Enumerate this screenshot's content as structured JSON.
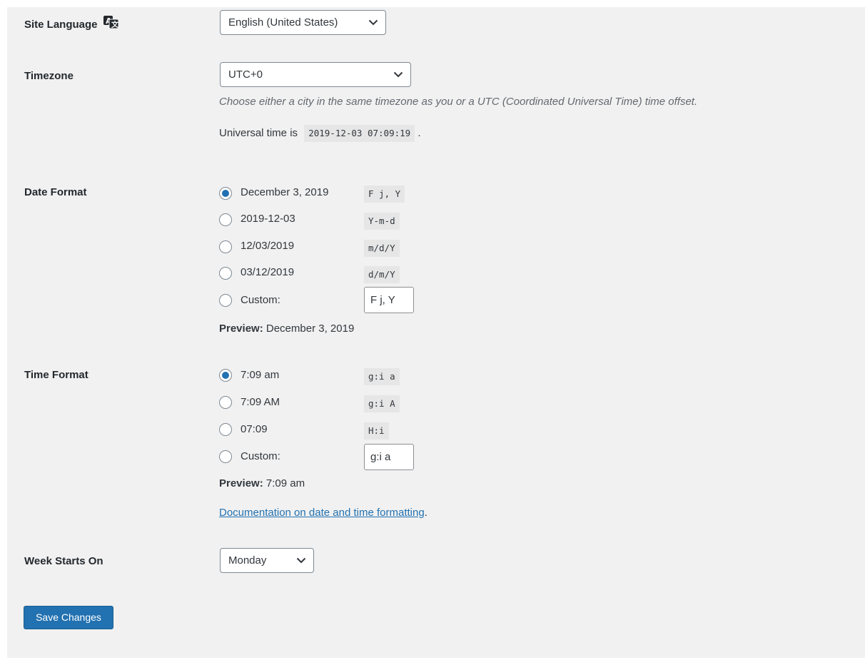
{
  "site_language": {
    "label": "Site Language",
    "icon": "translation-icon",
    "selected": "English (United States)"
  },
  "timezone": {
    "label": "Timezone",
    "selected": "UTC+0",
    "description": "Choose either a city in the same timezone as you or a UTC (Coordinated Universal Time) time offset.",
    "universal_prefix": "Universal time is",
    "universal_value": "2019-12-03 07:09:19",
    "universal_suffix": "."
  },
  "date_format": {
    "label": "Date Format",
    "options": [
      {
        "label": "December 3, 2019",
        "code": "F j, Y",
        "checked": true
      },
      {
        "label": "2019-12-03",
        "code": "Y-m-d",
        "checked": false
      },
      {
        "label": "12/03/2019",
        "code": "m/d/Y",
        "checked": false
      },
      {
        "label": "03/12/2019",
        "code": "d/m/Y",
        "checked": false
      }
    ],
    "custom_label": "Custom:",
    "custom_value": "F j, Y",
    "preview_label": "Preview:",
    "preview_value": "December 3, 2019"
  },
  "time_format": {
    "label": "Time Format",
    "options": [
      {
        "label": "7:09 am",
        "code": "g:i a",
        "checked": true
      },
      {
        "label": "7:09 AM",
        "code": "g:i A",
        "checked": false
      },
      {
        "label": "07:09",
        "code": "H:i",
        "checked": false
      }
    ],
    "custom_label": "Custom:",
    "custom_value": "g:i a",
    "preview_label": "Preview:",
    "preview_value": "7:09 am"
  },
  "documentation": {
    "link_text": "Documentation on date and time formatting",
    "suffix": "."
  },
  "week_starts_on": {
    "label": "Week Starts On",
    "selected": "Monday"
  },
  "save_button": "Save Changes",
  "colors": {
    "panel_bg": "#f1f1f1",
    "primary": "#2271b1",
    "link": "#2271b1",
    "code_bg": "#e6e6e6"
  }
}
